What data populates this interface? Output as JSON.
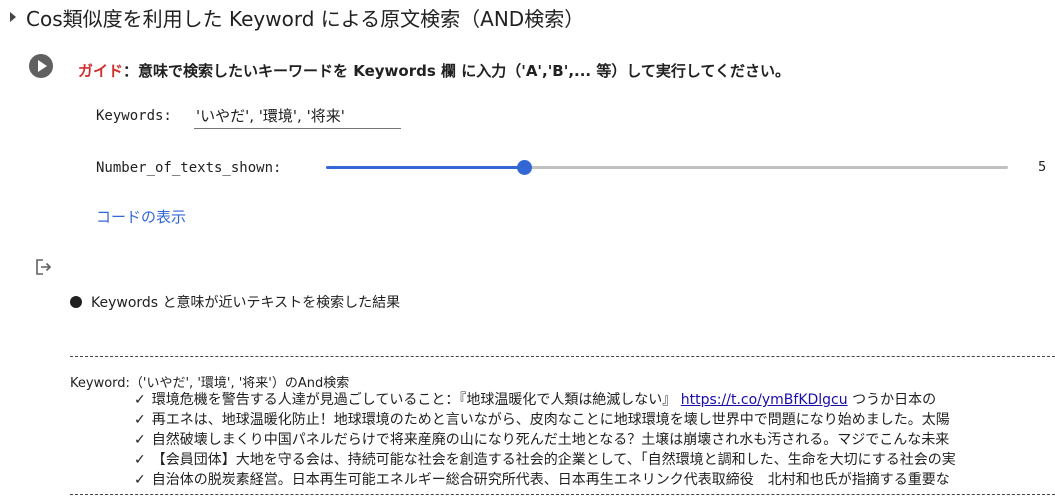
{
  "section": {
    "title": "Cos類似度を利用した Keyword による原文検索（AND検索）"
  },
  "guide": {
    "label": "ガイド",
    "text": "：意味で検索したいキーワードを Keywords 欄 に入力（'A','B',... 等）して実行してください。"
  },
  "form": {
    "keywords_label": "Keywords:",
    "keywords_value": "'いやだ', '環境', '将来'",
    "num_texts_label": "Number_of_texts_shown:",
    "num_texts_value": "5",
    "slider_fraction": 0.29,
    "show_code_link": "コードの表示"
  },
  "output": {
    "heading": "Keywords と意味が近いテキストを検索した結果",
    "query_line": "Keyword:（'いやだ', '環境', '将来'）のAnd検索",
    "check_mark": "✓",
    "results": [
      {
        "text": "環境危機を警告する人達が見過ごしていること：『地球温暖化で人類は絶滅しない』 ",
        "link": "https://t.co/ymBfKDlgcu",
        "after": " つうか日本の"
      },
      {
        "text": "再エネは、地球温暖化防止！地球環境のためと言いながら、皮肉なことに地球環境を壊し世界中で問題になり始めました。太陽",
        "link": "",
        "after": ""
      },
      {
        "text": "自然破壊しまくり中国パネルだらけで将来産廃の山になり死んだ土地となる？土壌は崩壊され水も汚される。マジでこんな未来",
        "link": "",
        "after": ""
      },
      {
        "text": "【会員団体】大地を守る会は、持続可能な社会を創造する社会的企業として、「自然環境と調和した、生命を大切にする社会の実",
        "link": "",
        "after": ""
      },
      {
        "text": "自治体の脱炭素経営。日本再生可能エネルギー総合研究所代表、日本再生エネリンク代表取締役　北村和也氏が指摘する重要な",
        "link": "",
        "after": ""
      }
    ]
  },
  "colors": {
    "accent": "#3367d6",
    "guide_label": "#d32f2f",
    "link": "#1a0dab"
  }
}
